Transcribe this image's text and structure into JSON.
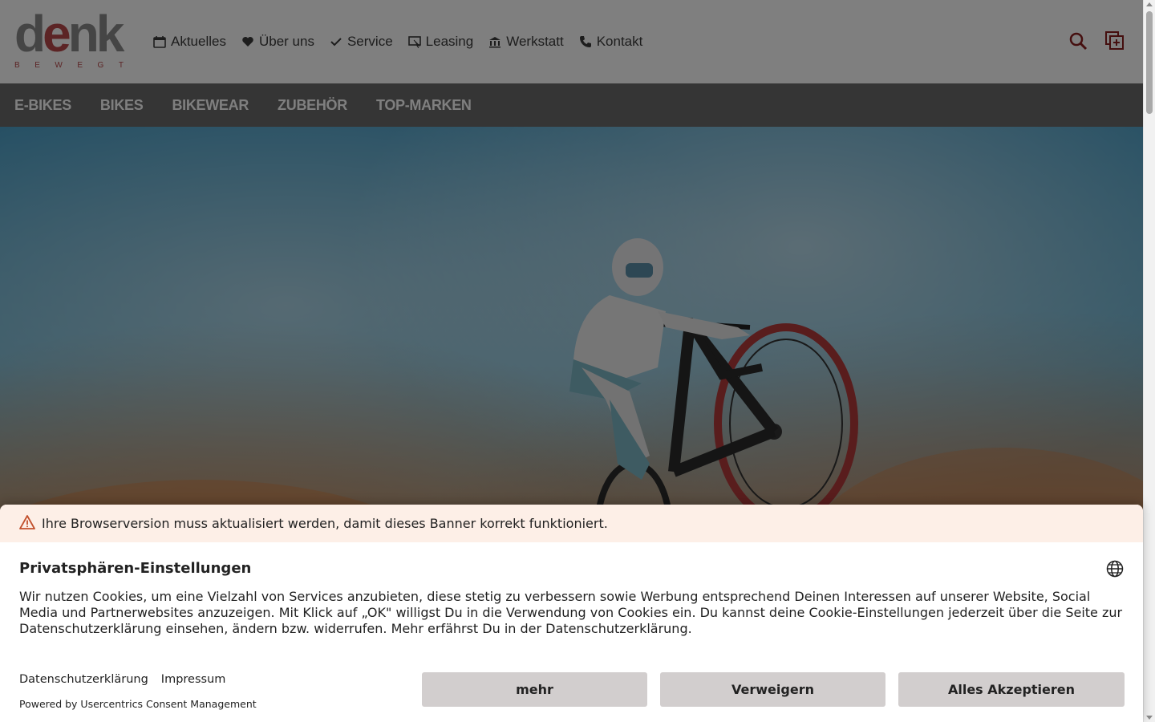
{
  "header": {
    "logo_text_main": "denk",
    "logo_text_sub": [
      "B",
      "E",
      "W",
      "E",
      "G",
      "T"
    ],
    "nav": [
      {
        "label": "Aktuelles",
        "icon": "calendar-icon"
      },
      {
        "label": "Über uns",
        "icon": "heart-icon"
      },
      {
        "label": "Service",
        "icon": "check-icon"
      },
      {
        "label": "Leasing",
        "icon": "leasing-icon"
      },
      {
        "label": "Werkstatt",
        "icon": "workshop-icon"
      },
      {
        "label": "Kontakt",
        "icon": "phone-icon"
      }
    ],
    "actions": [
      {
        "icon": "search-icon"
      },
      {
        "icon": "compare-add-icon"
      }
    ]
  },
  "categories": [
    "E-BIKES",
    "BIKES",
    "BIKEWEAR",
    "ZUBEHÖR",
    "TOP-MARKEN"
  ],
  "consent": {
    "warning": "Ihre Browserversion muss aktualisiert werden, damit dieses Banner korrekt funktioniert.",
    "title": "Privatsphären-Einstellungen",
    "text": "Wir nutzen Cookies, um eine Vielzahl von Services anzubieten, diese stetig zu verbessern sowie Werbung entsprechend Deinen Interessen auf unserer Website, Social Media und Partnerwebsites anzuzeigen. Mit Klick auf „OK\" willigst Du in die Verwendung von Cookies ein. Du kannst deine Cookie-Einstellungen jederzeit über die Seite zur Datenschutzerklärung einsehen, ändern bzw. widerrufen. Mehr erfährst Du in der Datenschutzerklärung.",
    "links": {
      "privacy": "Datenschutzerklärung",
      "imprint": "Impressum"
    },
    "powered_by": "Powered by Usercentrics Consent Management",
    "buttons": {
      "more": "mehr",
      "deny": "Verweigern",
      "accept": "Alles Akzeptieren"
    }
  },
  "colors": {
    "brand_red": "#b8494b",
    "category_bar": "#6b6b6b",
    "button_bg": "#d2cece",
    "warning_bg": "#fdefe7"
  }
}
